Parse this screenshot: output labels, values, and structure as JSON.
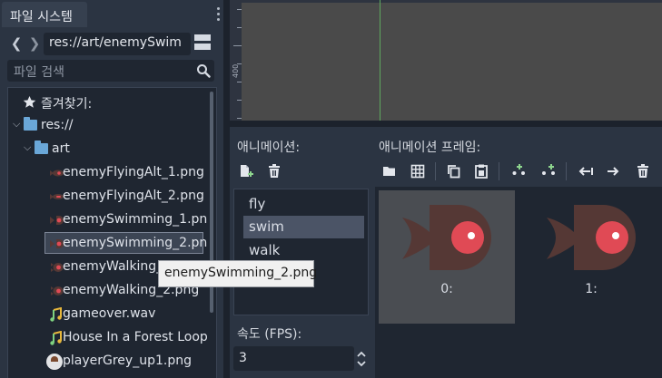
{
  "file_system": {
    "tab_label": "파일 시스템",
    "nav_back": "❮",
    "nav_forward": "❯",
    "path": "res://art/enemySwim",
    "search_placeholder": "파일 검색",
    "tree": {
      "favorites": "즐겨찾기:",
      "root": "res://",
      "art_folder": "art",
      "files": [
        {
          "name": "enemyFlyingAlt_1.png",
          "icon": "fish-fly-icon"
        },
        {
          "name": "enemyFlyingAlt_2.png",
          "icon": "fish-fly-icon"
        },
        {
          "name": "enemySwimming_1.pn",
          "icon": "fish-swim-icon"
        },
        {
          "name": "enemySwimming_2.pn",
          "icon": "fish-swim-icon"
        },
        {
          "name": "enemyWalking_",
          "icon": "fish-walk-icon"
        },
        {
          "name": "enemyWalking_2.png",
          "icon": "fish-walk-icon"
        },
        {
          "name": "gameover.wav",
          "icon": "music-icon"
        },
        {
          "name": "House In a Forest Loop",
          "icon": "music-icon"
        },
        {
          "name": "playerGrey_up1.png",
          "icon": "player-icon"
        }
      ]
    }
  },
  "viewport": {
    "ruler_value": "400"
  },
  "sprite_frames": {
    "animations_label": "애니메이션:",
    "frames_label": "애니메이션 프레임:",
    "animations": [
      {
        "name": "fly",
        "selected": false
      },
      {
        "name": "swim",
        "selected": true
      },
      {
        "name": "walk",
        "selected": false
      }
    ],
    "fps_label": "속도 (FPS):",
    "fps_value": "3",
    "frames": [
      {
        "label": "0:",
        "selected": true
      },
      {
        "label": "1:",
        "selected": false
      }
    ]
  },
  "tooltip": {
    "text": "enemySwimming_2.png"
  },
  "colors": {
    "fish_body": "#553835",
    "fish_eye": "#e04a55",
    "folder": "#6aa7d8",
    "green_axis": "#5ea85e",
    "music_note": "#e8b83c"
  }
}
